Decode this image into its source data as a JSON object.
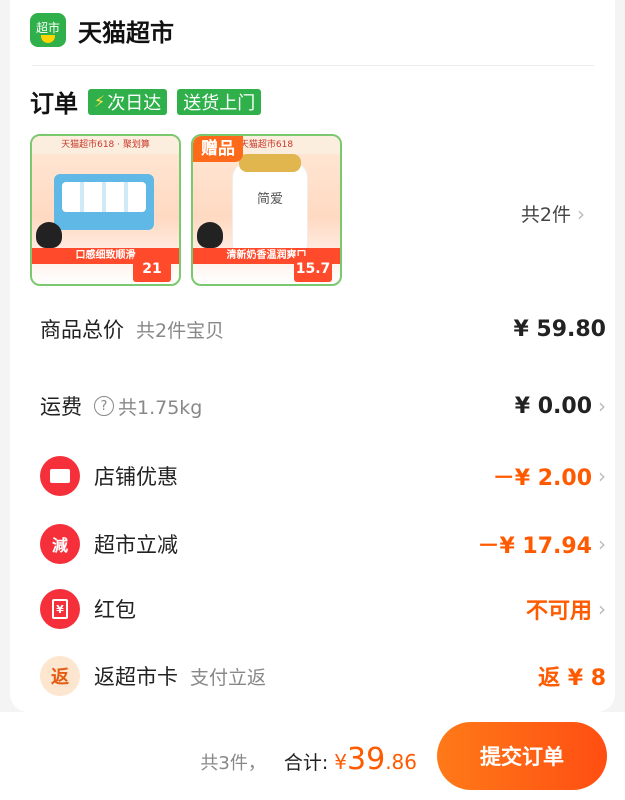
{
  "store": {
    "logo_text": "超市",
    "name": "天猫超市"
  },
  "order": {
    "title": "订单",
    "tags": [
      "次日达",
      "送货上门"
    ]
  },
  "products": [
    {
      "top_text": "天猫超市618 · 聚划算",
      "caption": "口感细致顺滑",
      "price": "21",
      "gift": ""
    },
    {
      "top_text": "天猫超市618",
      "caption": "清新奶香温润爽口",
      "price": "15.7",
      "gift": "赠品",
      "brand": "简爱"
    }
  ],
  "more_items": "共2件",
  "rows": {
    "goods_total": {
      "label": "商品总价",
      "sub": "共2件宝贝",
      "value": "¥ 59.80"
    },
    "shipping": {
      "label": "运费",
      "sub": "共1.75kg",
      "value": "¥ 0.00"
    },
    "shop_discount": {
      "label": "店铺优惠",
      "value": "－¥ 2.00"
    },
    "market_discount": {
      "label": "超市立减",
      "icon_text": "減",
      "value": "－¥ 17.94"
    },
    "red_packet": {
      "label": "红包",
      "icon_text": "¥",
      "value": "不可用"
    },
    "card_back": {
      "label": "返超市卡",
      "sub": "支付立返",
      "icon_text": "返",
      "value": "返 ¥ 8"
    }
  },
  "footer": {
    "count": "共3件，",
    "total_label": "合计:",
    "total_yen": "¥",
    "total_int": "39",
    "total_dec": ".86",
    "submit": "提交订单"
  },
  "colors": {
    "accent": "#ff5a00",
    "brand_green": "#2fb04a",
    "red": "#f5303a"
  }
}
